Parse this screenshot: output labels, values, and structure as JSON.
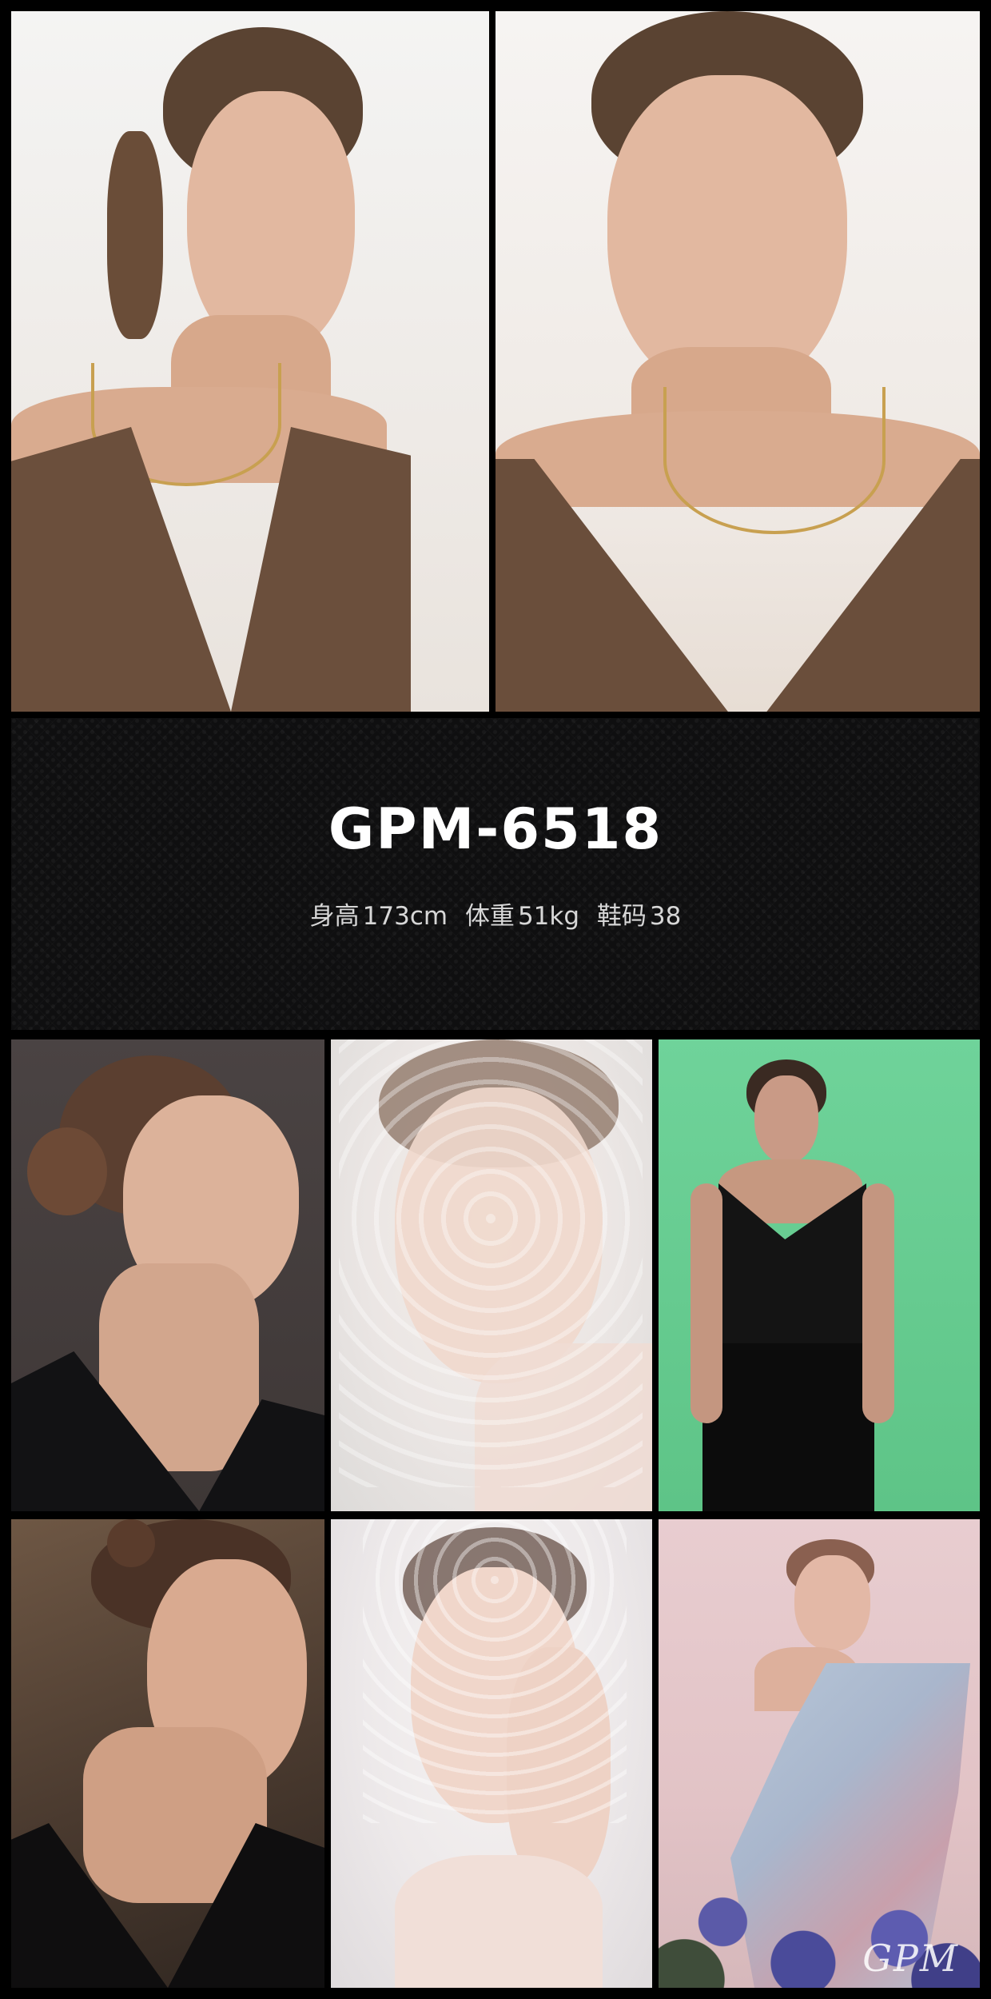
{
  "model": {
    "id": "GPM-6518",
    "height_label": "身高",
    "height_value": "173cm",
    "weight_label": "体重",
    "weight_value": "51kg",
    "shoe_label": "鞋码",
    "shoe_value": "38"
  },
  "watermark": "GPM",
  "photos": [
    {
      "name": "photo-1"
    },
    {
      "name": "photo-2"
    },
    {
      "name": "photo-3"
    },
    {
      "name": "photo-4"
    },
    {
      "name": "photo-5"
    },
    {
      "name": "photo-6"
    },
    {
      "name": "photo-7"
    },
    {
      "name": "photo-8"
    }
  ]
}
